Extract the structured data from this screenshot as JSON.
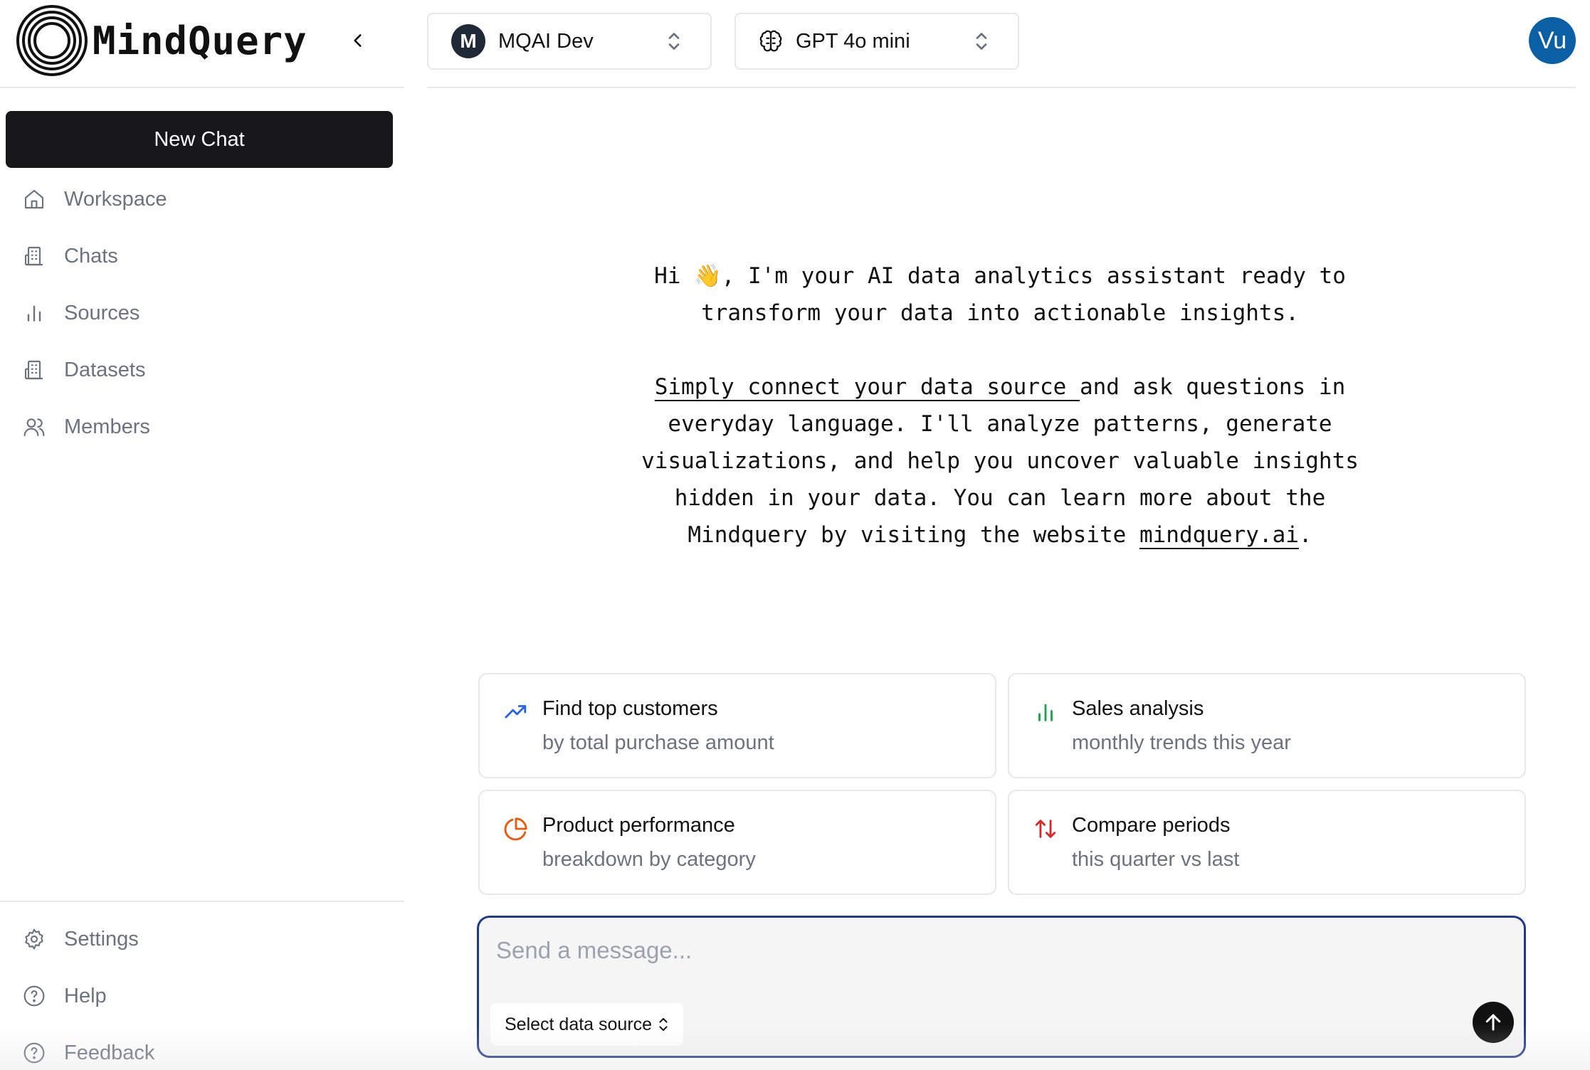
{
  "sidebar": {
    "brand": "MindQuery",
    "new_chat_label": "New Chat",
    "items": [
      {
        "label": "Workspace",
        "icon": "home-icon"
      },
      {
        "label": "Chats",
        "icon": "building-icon"
      },
      {
        "label": "Sources",
        "icon": "bar-chart-icon"
      },
      {
        "label": "Datasets",
        "icon": "building-icon"
      },
      {
        "label": "Members",
        "icon": "users-icon"
      }
    ],
    "footer_items": [
      {
        "label": "Settings",
        "icon": "gear-icon"
      },
      {
        "label": "Help",
        "icon": "help-circle-icon"
      },
      {
        "label": "Feedback",
        "icon": "help-circle-icon"
      }
    ]
  },
  "header": {
    "workspace_badge": "M",
    "workspace_name": "MQAI Dev",
    "model_name": "GPT 4o mini",
    "user_initials": "Vu"
  },
  "intro": {
    "greeting": "Hi 👋, I'm your AI data analytics assistant ready to transform your data into actionable insights.",
    "link_text": "Simply connect your data source ",
    "body": "and ask questions in everyday language. I'll analyze patterns, generate visualizations, and help you uncover valuable insights hidden in your data. You can learn more about the Mindquery by visiting the website ",
    "website": "mindquery.ai",
    "period": "."
  },
  "suggestions": [
    {
      "title": "Find top customers",
      "subtitle": "by total purchase amount",
      "icon": "trending-up-icon",
      "color": "#2563eb"
    },
    {
      "title": "Sales analysis",
      "subtitle": "monthly trends this year",
      "icon": "bar-chart-icon",
      "color": "#16a34a"
    },
    {
      "title": "Product performance",
      "subtitle": "breakdown by category",
      "icon": "pie-chart-icon",
      "color": "#ea580c"
    },
    {
      "title": "Compare periods",
      "subtitle": "this quarter vs last",
      "icon": "arrows-up-down-icon",
      "color": "#dc2626"
    }
  ],
  "composer": {
    "placeholder": "Send a message...",
    "data_source_label": "Select data source"
  },
  "colors": {
    "primary_button": "#18181b",
    "avatar": "#0b5fa5",
    "composer_border": "#1e3a8a"
  }
}
